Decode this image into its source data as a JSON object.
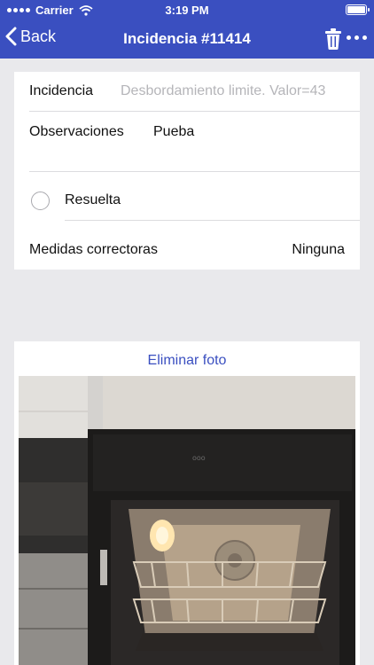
{
  "status_bar": {
    "carrier": "Carrier",
    "time": "3:19 PM"
  },
  "nav": {
    "back_label": "Back",
    "title": "Incidencia #11414",
    "trash_icon": "trash-icon",
    "more_icon": "more-icon"
  },
  "form": {
    "incidencia_label": "Incidencia",
    "incidencia_value": "Desbordamiento limite. Valor=43",
    "observaciones_label": "Observaciones",
    "observaciones_value": "Pueba",
    "resuelta_label": "Resuelta",
    "resuelta_checked": false,
    "medidas_label": "Medidas correctoras",
    "medidas_value": "Ninguna"
  },
  "photo": {
    "delete_label": "Eliminar foto",
    "image": "photo of an oven"
  },
  "colors": {
    "accent": "#3a4fc0",
    "background": "#e9e9ec",
    "card": "#ffffff",
    "placeholder": "#b5b5b9"
  }
}
